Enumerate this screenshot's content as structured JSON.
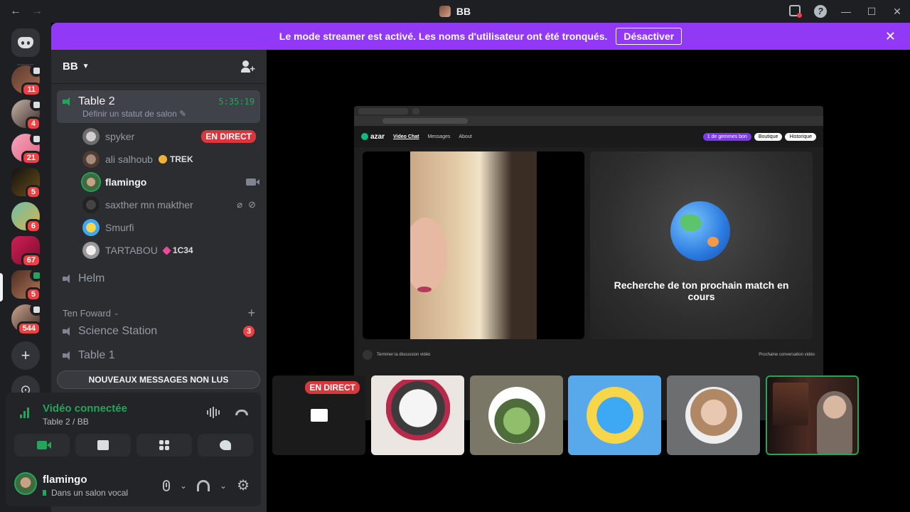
{
  "window": {
    "title": "BB",
    "back": "←",
    "forward": "→",
    "minimize": "—",
    "maximize": "☐",
    "close": "✕",
    "help": "?"
  },
  "banner": {
    "text": "Le mode streamer est activé. Les noms d'utilisateur ont été tronqués.",
    "button": "Désactiver",
    "close": "✕"
  },
  "servers": [
    {
      "badge": "11"
    },
    {
      "badge": "4"
    },
    {
      "badge": "21"
    },
    {
      "badge": "5"
    },
    {
      "badge": "6"
    },
    {
      "badge": "67"
    },
    {
      "badge": "5"
    },
    {
      "badge": "544"
    }
  ],
  "rail": {
    "add": "+",
    "discover": "⊙"
  },
  "guild": {
    "name": "BB"
  },
  "channels": {
    "active": {
      "name": "Table 2",
      "timer": "5:35:19",
      "status": "Définir un statut de salon"
    },
    "members": [
      {
        "name": "spyker",
        "badge": "EN DIRECT"
      },
      {
        "name": "ali salhoub",
        "tag": "TREK"
      },
      {
        "name": "flamingo"
      },
      {
        "name": "saxther mn makther"
      },
      {
        "name": "Smurfi"
      },
      {
        "name": "TARTABOU",
        "tag": "1C34"
      }
    ],
    "helm": "Helm",
    "category": "Ten Foward",
    "category_add": "+",
    "science": {
      "name": "Science Station",
      "badge": "3"
    },
    "table1": "Table 1"
  },
  "new_messages": "NOUVEAUX MESSAGES NON LUS",
  "voice": {
    "title": "Vidéo connectée",
    "subtitle": "Table 2 / BB"
  },
  "user": {
    "name": "flamingo",
    "status": "Dans un salon vocal"
  },
  "stream": {
    "logo": "azar",
    "nav": [
      "Video Chat",
      "Messages",
      "About"
    ],
    "pill1": "1 de gemmes bon",
    "pill2": "Boutique",
    "pill3": "Historique",
    "searching": "Recherche de ton prochain match en cours",
    "end_label": "Terminer la discussion vidéo",
    "next_label": "Prochaine conversation vidéo",
    "esc": "esc"
  },
  "tiles": {
    "live": "EN DIRECT"
  },
  "colors": {
    "accent": "#9239f5",
    "online": "#23a55a",
    "danger": "#da373c"
  }
}
